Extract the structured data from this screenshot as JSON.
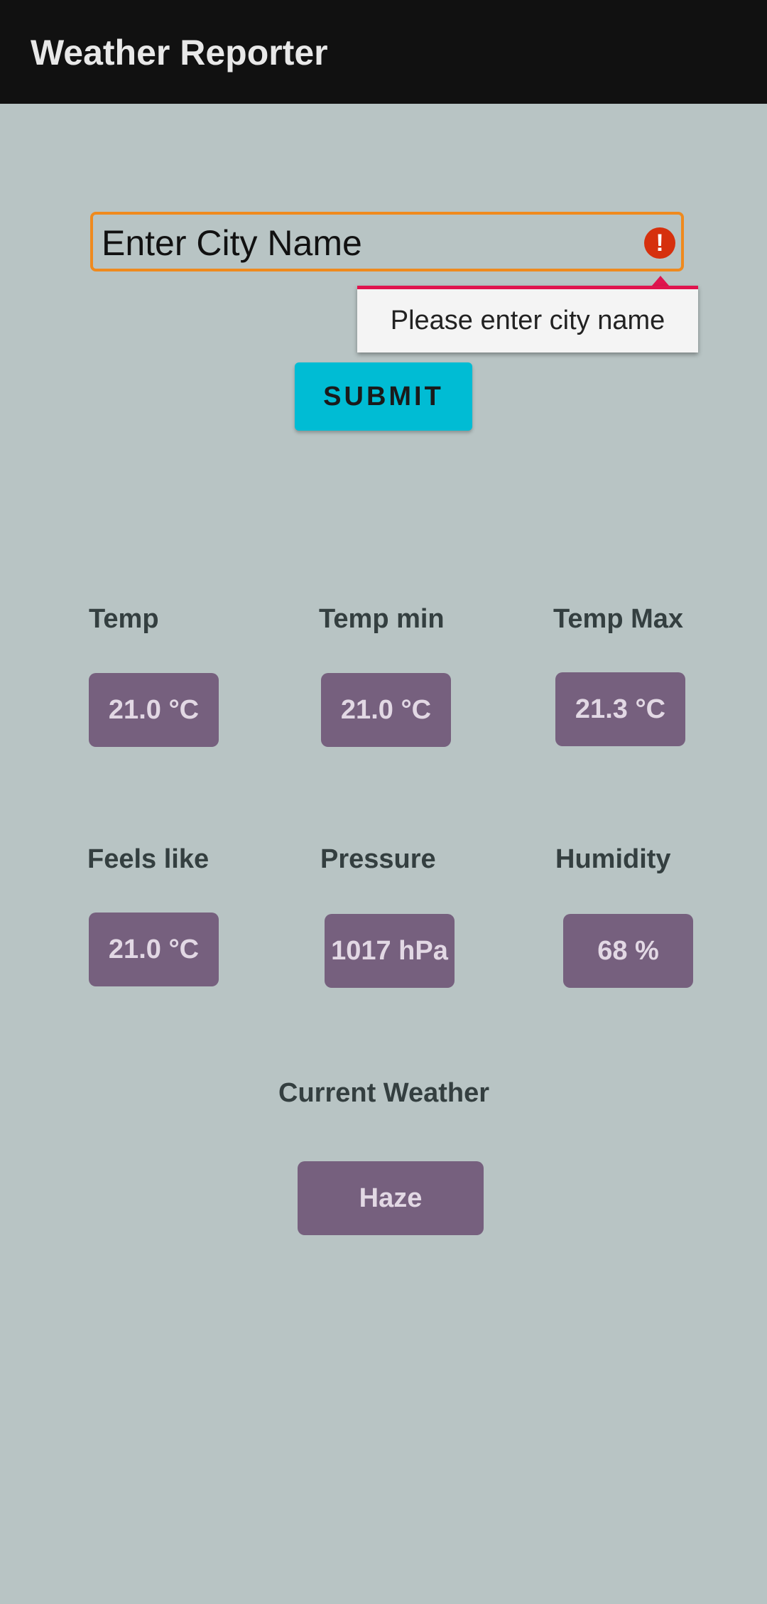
{
  "app_bar": {
    "title": "Weather Reporter"
  },
  "city_input": {
    "placeholder": "Enter City Name",
    "error_icon": "error-icon",
    "error_message": "Please enter city name"
  },
  "submit": {
    "label": "SUBMIT"
  },
  "weather": {
    "temp": {
      "label": "Temp",
      "value": "21.0 °C"
    },
    "temp_min": {
      "label": "Temp min",
      "value": "21.0 °C"
    },
    "temp_max": {
      "label": "Temp Max",
      "value": "21.3 °C"
    },
    "feels_like": {
      "label": "Feels like",
      "value": "21.0 °C"
    },
    "pressure": {
      "label": "Pressure",
      "value": "1017 hPa"
    },
    "humidity": {
      "label": "Humidity",
      "value": "68 %"
    },
    "current": {
      "label": "Current Weather",
      "value": "Haze"
    }
  },
  "colors": {
    "background": "#b8c4c4",
    "app_bar": "#111111",
    "input_border": "#ef8a1e",
    "error": "#d6300d",
    "submit": "#00bcd4",
    "value_box": "#76607e"
  }
}
